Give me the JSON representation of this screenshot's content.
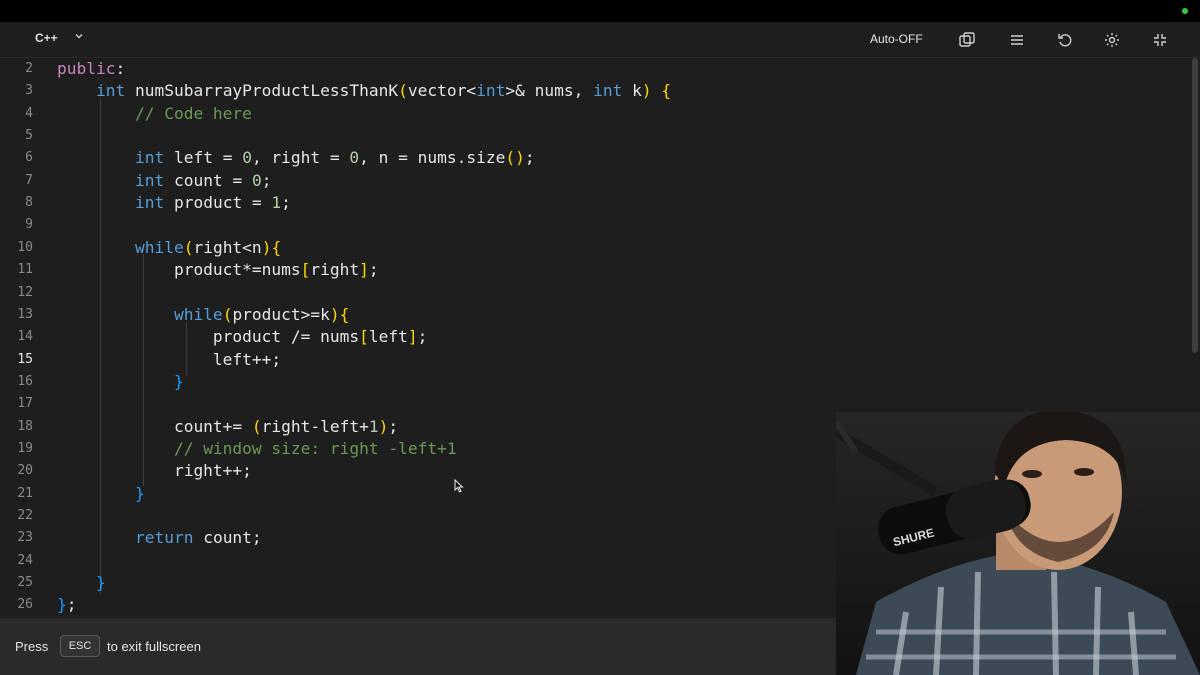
{
  "toolbar": {
    "language": "C++",
    "auto_mode": "Auto-OFF",
    "icons": [
      "language-dropdown-icon",
      "copy-icon",
      "list-icon",
      "reset-icon",
      "settings-icon",
      "minimize-icon"
    ]
  },
  "editor": {
    "active_line": 15,
    "lines": [
      {
        "n": "2",
        "text": "public:"
      },
      {
        "n": "3",
        "text": "    int numSubarrayProductLessThanK(vector<int>& nums, int k) {"
      },
      {
        "n": "4",
        "text": "        // Code here"
      },
      {
        "n": "5",
        "text": ""
      },
      {
        "n": "6",
        "text": "        int left = 0, right = 0, n = nums.size();"
      },
      {
        "n": "7",
        "text": "        int count = 0;"
      },
      {
        "n": "8",
        "text": "        int product = 1;"
      },
      {
        "n": "9",
        "text": ""
      },
      {
        "n": "10",
        "text": "        while(right<n){"
      },
      {
        "n": "11",
        "text": "            product*=nums[right];"
      },
      {
        "n": "12",
        "text": ""
      },
      {
        "n": "13",
        "text": "            while(product>=k){"
      },
      {
        "n": "14",
        "text": "                product /= nums[left];"
      },
      {
        "n": "15",
        "text": "                left++;"
      },
      {
        "n": "16",
        "text": "            }"
      },
      {
        "n": "17",
        "text": ""
      },
      {
        "n": "18",
        "text": "            count+= (right-left+1);"
      },
      {
        "n": "19",
        "text": "            // window size: right -left+1"
      },
      {
        "n": "20",
        "text": "            right++;"
      },
      {
        "n": "21",
        "text": "        }"
      },
      {
        "n": "22",
        "text": ""
      },
      {
        "n": "23",
        "text": "        return count;"
      },
      {
        "n": "24",
        "text": ""
      },
      {
        "n": "25",
        "text": "    }"
      },
      {
        "n": "26",
        "text": "};"
      }
    ]
  },
  "fullscreen_hint": {
    "press": "Press",
    "key": "ESC",
    "message": "to exit fullscreen"
  },
  "webcam": {
    "mic_brand": "SHURE"
  },
  "colors": {
    "background": "#1e1e1e",
    "keyword": "#569cd6",
    "comment": "#6a9955",
    "number": "#b5cea8",
    "bracket_gold": "#ffd700",
    "bracket_purple": "#da70d6",
    "bracket_blue": "#179fff"
  }
}
